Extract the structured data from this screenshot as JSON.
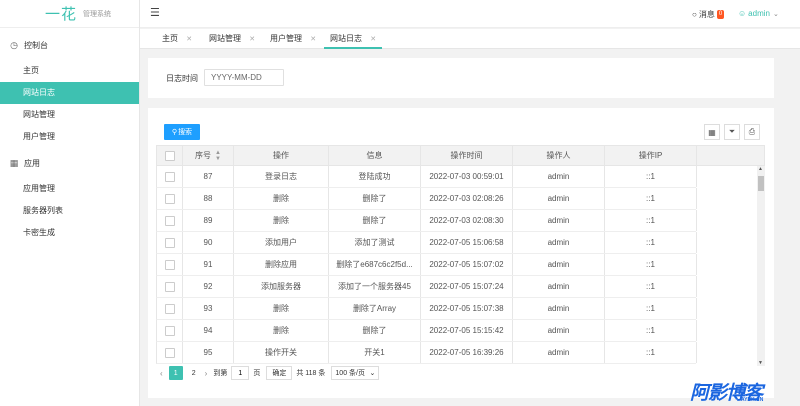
{
  "logo": {
    "main": "一花",
    "sub": "管理系统"
  },
  "sidebar": {
    "groups": [
      {
        "label": "控制台",
        "icon": "dashboard-icon",
        "items": [
          "主页",
          "网站日志",
          "网站管理",
          "用户管理"
        ]
      },
      {
        "label": "应用",
        "icon": "app-icon",
        "items": [
          "应用管理",
          "服务器列表",
          "卡密生成"
        ]
      }
    ],
    "active_item": "网站日志"
  },
  "topbar": {
    "messages_label": "消息",
    "messages_count": "0",
    "user_name": "admin"
  },
  "tabs": [
    {
      "label": "主页"
    },
    {
      "label": "网站管理"
    },
    {
      "label": "用户管理"
    },
    {
      "label": "网站日志",
      "active": true
    }
  ],
  "filter": {
    "date_label": "日志时间",
    "date_placeholder": "YYYY-MM-DD"
  },
  "toolbar": {
    "search_label": "搜索"
  },
  "table": {
    "columns": [
      "序号",
      "操作",
      "信息",
      "操作时间",
      "操作人",
      "操作IP"
    ],
    "rows": [
      {
        "id": "87",
        "action": "登录日志",
        "info": "登陆成功",
        "time": "2022-07-03 00:59:01",
        "user": "admin",
        "ip": "::1"
      },
      {
        "id": "88",
        "action": "删除",
        "info": "删除了",
        "time": "2022-07-03 02:08:26",
        "user": "admin",
        "ip": "::1"
      },
      {
        "id": "89",
        "action": "删除",
        "info": "删除了",
        "time": "2022-07-03 02:08:30",
        "user": "admin",
        "ip": "::1"
      },
      {
        "id": "90",
        "action": "添加用户",
        "info": "添加了测试",
        "time": "2022-07-05 15:06:58",
        "user": "admin",
        "ip": "::1"
      },
      {
        "id": "91",
        "action": "删除应用",
        "info": "删除了e687c6c2f5d...",
        "time": "2022-07-05 15:07:02",
        "user": "admin",
        "ip": "::1"
      },
      {
        "id": "92",
        "action": "添加服务器",
        "info": "添加了一个服务器45",
        "time": "2022-07-05 15:07:24",
        "user": "admin",
        "ip": "::1"
      },
      {
        "id": "93",
        "action": "删除",
        "info": "删除了Array",
        "time": "2022-07-05 15:07:38",
        "user": "admin",
        "ip": "::1"
      },
      {
        "id": "94",
        "action": "删除",
        "info": "删除了",
        "time": "2022-07-05 15:15:42",
        "user": "admin",
        "ip": "::1"
      },
      {
        "id": "95",
        "action": "操作开关",
        "info": "开关1",
        "time": "2022-07-05 16:39:26",
        "user": "admin",
        "ip": "::1"
      }
    ]
  },
  "pagination": {
    "pages": [
      "1",
      "2"
    ],
    "current": "1",
    "goto_prefix": "到第",
    "goto_value": "1",
    "goto_suffix": "页",
    "confirm": "确定",
    "total": "共 118 条",
    "page_size": "100 条/页"
  },
  "watermark": {
    "main": "阿影博客",
    "sub": "AYBK.CN"
  },
  "colors": {
    "accent": "#3ec1b1",
    "primary_button": "#1e9fff",
    "badge": "#ff5722"
  }
}
